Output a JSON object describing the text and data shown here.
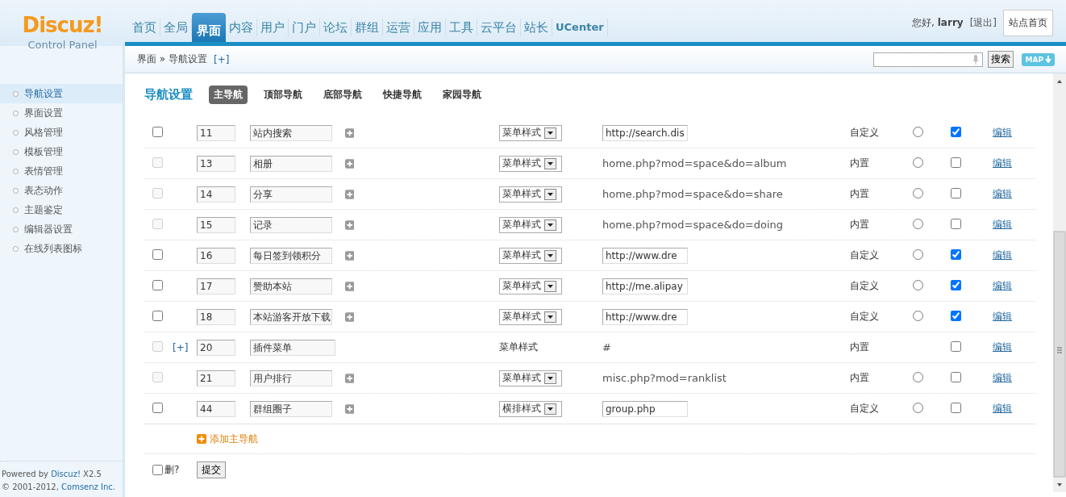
{
  "logo": {
    "name": "Discuz!",
    "subtitle": "Control Panel"
  },
  "top_nav": [
    {
      "label": "首页",
      "selected": false
    },
    {
      "label": "全局",
      "selected": false
    },
    {
      "label": "界面",
      "selected": true
    },
    {
      "label": "内容",
      "selected": false
    },
    {
      "label": "用户",
      "selected": false
    },
    {
      "label": "门户",
      "selected": false
    },
    {
      "label": "论坛",
      "selected": false
    },
    {
      "label": "群组",
      "selected": false
    },
    {
      "label": "运营",
      "selected": false
    },
    {
      "label": "应用",
      "selected": false
    },
    {
      "label": "工具",
      "selected": false
    },
    {
      "label": "云平台",
      "selected": false
    },
    {
      "label": "站长",
      "selected": false
    },
    {
      "label": "UCenter",
      "selected": false
    }
  ],
  "user": {
    "greeting": "您好, **larry**",
    "logout": "[退出]",
    "site_home": "站点首页"
  },
  "breadcrumb": {
    "path": "界面 » 导航设置",
    "add": "[+]"
  },
  "search": {
    "button": "搜索",
    "map": "MAP"
  },
  "sidebar": {
    "items": [
      {
        "label": "导航设置",
        "selected": true
      },
      {
        "label": "界面设置",
        "selected": false
      },
      {
        "label": "风格管理",
        "selected": false
      },
      {
        "label": "模板管理",
        "selected": false
      },
      {
        "label": "表情管理",
        "selected": false
      },
      {
        "label": "表态动作",
        "selected": false
      },
      {
        "label": "主题鉴定",
        "selected": false
      },
      {
        "label": "编辑器设置",
        "selected": false
      },
      {
        "label": "在线列表图标",
        "selected": false
      }
    ],
    "footer_powered": "Powered by ",
    "footer_brand": "Discuz!",
    "footer_version": " X2.5",
    "footer_copy": "© 2001-2012, ",
    "footer_company": "Comsenz Inc."
  },
  "page": {
    "title": "导航设置",
    "tabs": [
      {
        "label": "主导航",
        "selected": true
      },
      {
        "label": "顶部导航",
        "selected": false
      },
      {
        "label": "底部导航",
        "selected": false
      },
      {
        "label": "快捷导航",
        "selected": false
      },
      {
        "label": "家园导航",
        "selected": false
      }
    ]
  },
  "rows": [
    {
      "delete_disabled": false,
      "order": "11",
      "name": "站内搜索",
      "add_sub": true,
      "style": "菜单样式",
      "style_editable": true,
      "url": "http://search.dis",
      "url_editable": true,
      "type": "自定义",
      "radio": true,
      "shown": true,
      "edit": "编辑"
    },
    {
      "delete_disabled": true,
      "order": "13",
      "name": "相册",
      "add_sub": true,
      "style": "菜单样式",
      "style_editable": true,
      "url": "home.php?mod=space&do=album",
      "url_editable": false,
      "type": "内置",
      "radio": true,
      "shown": false,
      "edit": "编辑"
    },
    {
      "delete_disabled": true,
      "order": "14",
      "name": "分享",
      "add_sub": true,
      "style": "菜单样式",
      "style_editable": true,
      "url": "home.php?mod=space&do=share",
      "url_editable": false,
      "type": "内置",
      "radio": true,
      "shown": false,
      "edit": "编辑"
    },
    {
      "delete_disabled": true,
      "order": "15",
      "name": "记录",
      "add_sub": true,
      "style": "菜单样式",
      "style_editable": true,
      "url": "home.php?mod=space&do=doing",
      "url_editable": false,
      "type": "内置",
      "radio": true,
      "shown": false,
      "edit": "编辑"
    },
    {
      "delete_disabled": false,
      "order": "16",
      "name": "每日签到领积分",
      "add_sub": true,
      "style": "菜单样式",
      "style_editable": true,
      "url": "http://www.dre",
      "url_editable": true,
      "type": "自定义",
      "radio": true,
      "shown": true,
      "edit": "编辑"
    },
    {
      "delete_disabled": false,
      "order": "17",
      "name": "赞助本站",
      "add_sub": true,
      "style": "菜单样式",
      "style_editable": true,
      "url": "http://me.alipay",
      "url_editable": true,
      "type": "自定义",
      "radio": true,
      "shown": true,
      "edit": "编辑"
    },
    {
      "delete_disabled": false,
      "order": "18",
      "name": "本站游客开放下载",
      "add_sub": true,
      "style": "菜单样式",
      "style_editable": true,
      "url": "http://www.dre",
      "url_editable": true,
      "type": "自定义",
      "radio": true,
      "shown": true,
      "edit": "编辑"
    },
    {
      "delete_disabled": true,
      "sub_toggle": "[+]",
      "order": "20",
      "name": "插件菜单",
      "add_sub": false,
      "style": "菜单样式",
      "style_editable": false,
      "url": "#",
      "url_editable": false,
      "type": "内置",
      "radio": false,
      "shown": false,
      "edit": "编辑"
    },
    {
      "delete_disabled": true,
      "order": "21",
      "name": "用户排行",
      "add_sub": true,
      "style": "菜单样式",
      "style_editable": true,
      "url": "misc.php?mod=ranklist",
      "url_editable": false,
      "type": "内置",
      "radio": true,
      "shown": false,
      "edit": "编辑"
    },
    {
      "delete_disabled": false,
      "order": "44",
      "name": "群组圈子",
      "add_sub": true,
      "style": "横排样式",
      "style_editable": true,
      "url": "group.php",
      "url_editable": true,
      "type": "自定义",
      "radio": true,
      "shown": false,
      "edit": "编辑"
    }
  ],
  "add_link": "添加主导航",
  "delete_all": {
    "label": "删?",
    "checked": false
  },
  "submit": "提交"
}
